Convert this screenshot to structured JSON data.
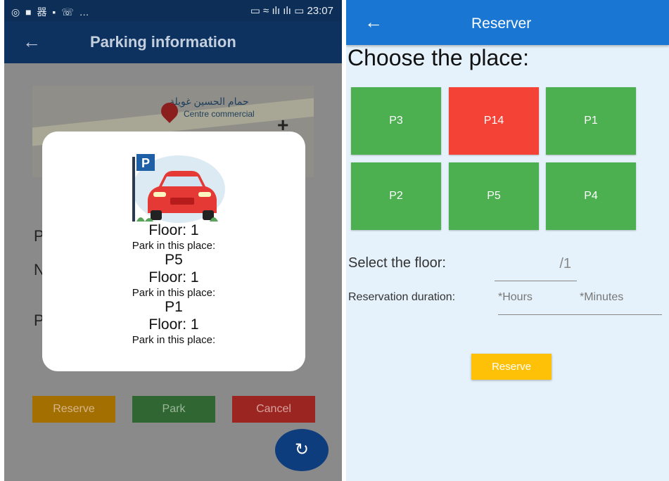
{
  "left": {
    "status_left": "◎ ■ 器 ▪ ☏ …",
    "status_right": "▭ ≈ ılı ılı ▭ 23:07",
    "back_icon": "←",
    "title": "Parking information",
    "map": {
      "arabic_label": "حمام الحسين غويلة",
      "commercial_label": "Centre commercial",
      "zoom_icon": "+"
    },
    "under_dialog_letters": [
      "P",
      "N",
      "P"
    ],
    "dialog": {
      "entries": [
        {
          "type": "floor",
          "text": "Floor: 1"
        },
        {
          "type": "park",
          "text": "Park in this place:"
        },
        {
          "type": "place",
          "text": "P5"
        },
        {
          "type": "floor",
          "text": "Floor: 1"
        },
        {
          "type": "park",
          "text": "Park in this place:"
        },
        {
          "type": "place",
          "text": "P1"
        },
        {
          "type": "floor",
          "text": "Floor: 1"
        },
        {
          "type": "park",
          "text": "Park in this place:"
        }
      ],
      "sign_letter": "P"
    },
    "buttons": {
      "reserve": "Reserve",
      "park": "Park",
      "cancel": "Cancel"
    },
    "fab_icon": "↻",
    "colors": {
      "appbar": "#0d3260",
      "reserve": "#a36f00",
      "park": "#2f6631",
      "cancel": "#9b2520",
      "fab": "#0d3d7d"
    }
  },
  "right": {
    "back_icon": "←",
    "title": "Reserver",
    "heading": "Choose the place:",
    "slots": [
      {
        "label": "P3",
        "status": "free",
        "color": "#4caf50"
      },
      {
        "label": "P14",
        "status": "occupied",
        "color": "#f44336"
      },
      {
        "label": "P1",
        "status": "free",
        "color": "#4caf50"
      },
      {
        "label": "P2",
        "status": "free",
        "color": "#4caf50"
      },
      {
        "label": "P5",
        "status": "free",
        "color": "#4caf50"
      },
      {
        "label": "P4",
        "status": "free",
        "color": "#4caf50"
      }
    ],
    "floor_label": "Select the floor:",
    "floor_suffix": "/1",
    "duration_label": "Reservation duration:",
    "hours_placeholder": "*Hours",
    "minutes_placeholder": "*Minutes",
    "reserve_button": "Reserve",
    "colors": {
      "appbar": "#1976d2",
      "background": "#e6f2fb",
      "reserve": "#ffc107"
    }
  }
}
